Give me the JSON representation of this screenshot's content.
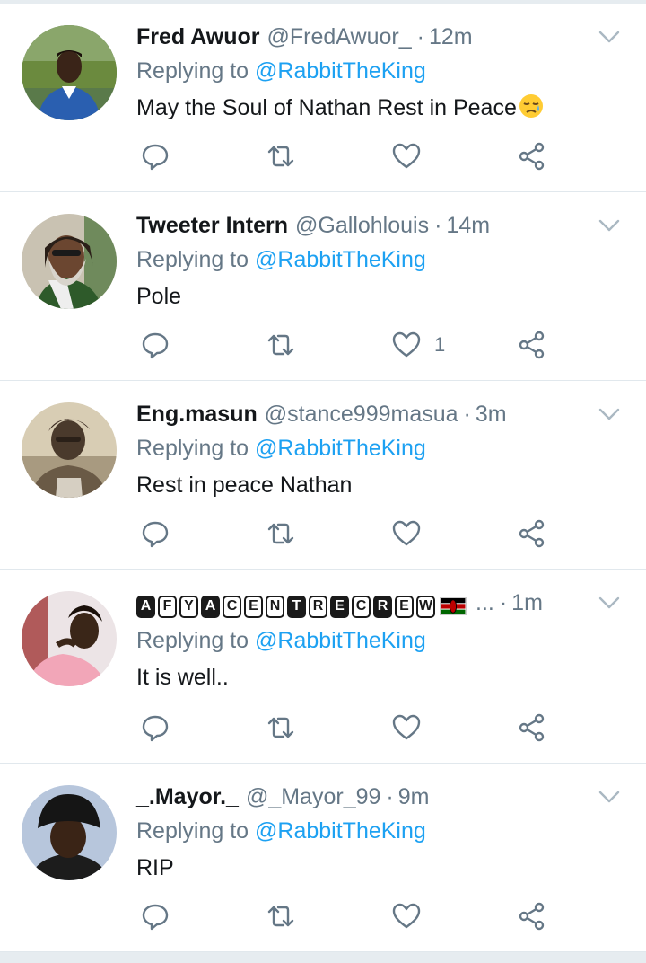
{
  "reply_prefix": "Replying to",
  "tweets": [
    {
      "name": "Fred Awuor",
      "handle": "@FredAwuor_",
      "sep": "·",
      "time": "12m",
      "mention": "@RabbitTheKing",
      "text": "May the Soul of Nathan Rest in Peace",
      "like_count": ""
    },
    {
      "name": "Tweeter Intern",
      "handle": "@Gallohlouis",
      "sep": "·",
      "time": "14m",
      "mention": "@RabbitTheKing",
      "text": "Pole",
      "like_count": "1"
    },
    {
      "name": "Eng.masun",
      "handle": "@stance999masua",
      "sep": "·",
      "time": "3m",
      "mention": "@RabbitTheKing",
      "text": "Rest in peace Nathan",
      "like_count": ""
    },
    {
      "name_letters": [
        "A",
        "F",
        "Y",
        "A",
        "C",
        "E",
        "N",
        "T",
        "R",
        "E",
        "C",
        "R",
        "E",
        "W"
      ],
      "name_letter_styles": [
        "f",
        "o",
        "o",
        "f",
        "o",
        "o",
        "o",
        "f",
        "o",
        "f",
        "o",
        "f",
        "o",
        "o"
      ],
      "ellipsis": "...",
      "sep": "·",
      "time": "1m",
      "mention": "@RabbitTheKing",
      "text": "It is well..",
      "like_count": ""
    },
    {
      "name": "_.Mayor._",
      "handle": "@_Mayor_99",
      "sep": "·",
      "time": "9m",
      "mention": "@RabbitTheKing",
      "text": "RIP",
      "like_count": ""
    }
  ],
  "colors": {
    "link": "#1da1f2",
    "secondary": "#657786",
    "divider": "#e1e8ed",
    "icon": "#657786"
  },
  "icons": {
    "reply": "reply-icon",
    "retweet": "retweet-icon",
    "like": "heart-icon",
    "share": "share-icon",
    "more": "chevron-down-icon"
  }
}
